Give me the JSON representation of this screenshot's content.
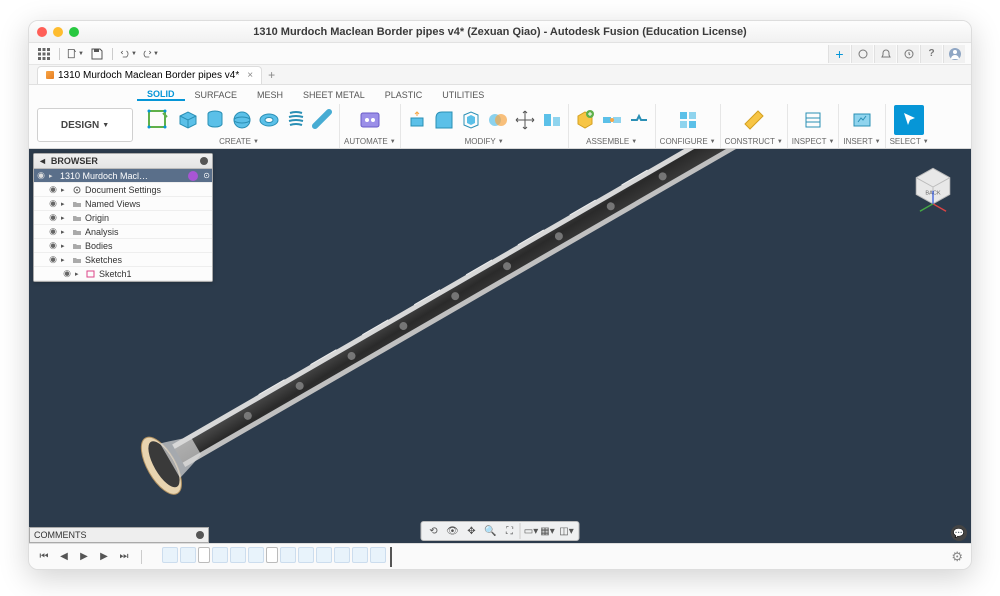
{
  "title": "1310 Murdoch Maclean Border pipes v4* (Zexuan Qiao) - Autodesk Fusion (Education License)",
  "tab": {
    "label": "1310 Murdoch Maclean Border pipes v4*"
  },
  "workspace": {
    "label": "DESIGN"
  },
  "ribbon_tabs": [
    "SOLID",
    "SURFACE",
    "MESH",
    "SHEET METAL",
    "PLASTIC",
    "UTILITIES"
  ],
  "ribbon_groups": {
    "create": "CREATE",
    "automate": "AUTOMATE",
    "modify": "MODIFY",
    "assemble": "ASSEMBLE",
    "configure": "CONFIGURE",
    "construct": "CONSTRUCT",
    "inspect": "INSPECT",
    "insert": "INSERT",
    "select": "SELECT"
  },
  "browser": {
    "title": "BROWSER",
    "root": "1310 Murdoch Macl…",
    "nodes": [
      {
        "label": "Document Settings",
        "icon": "gear",
        "indent": 1
      },
      {
        "label": "Named Views",
        "icon": "folder",
        "indent": 1
      },
      {
        "label": "Origin",
        "icon": "folder",
        "indent": 1
      },
      {
        "label": "Analysis",
        "icon": "folder",
        "indent": 1
      },
      {
        "label": "Bodies",
        "icon": "folder",
        "indent": 1
      },
      {
        "label": "Sketches",
        "icon": "folder",
        "indent": 1
      },
      {
        "label": "Sketch1",
        "icon": "sketch",
        "indent": 2
      }
    ]
  },
  "comments": "COMMENTS",
  "viewcube_face": "BACK"
}
